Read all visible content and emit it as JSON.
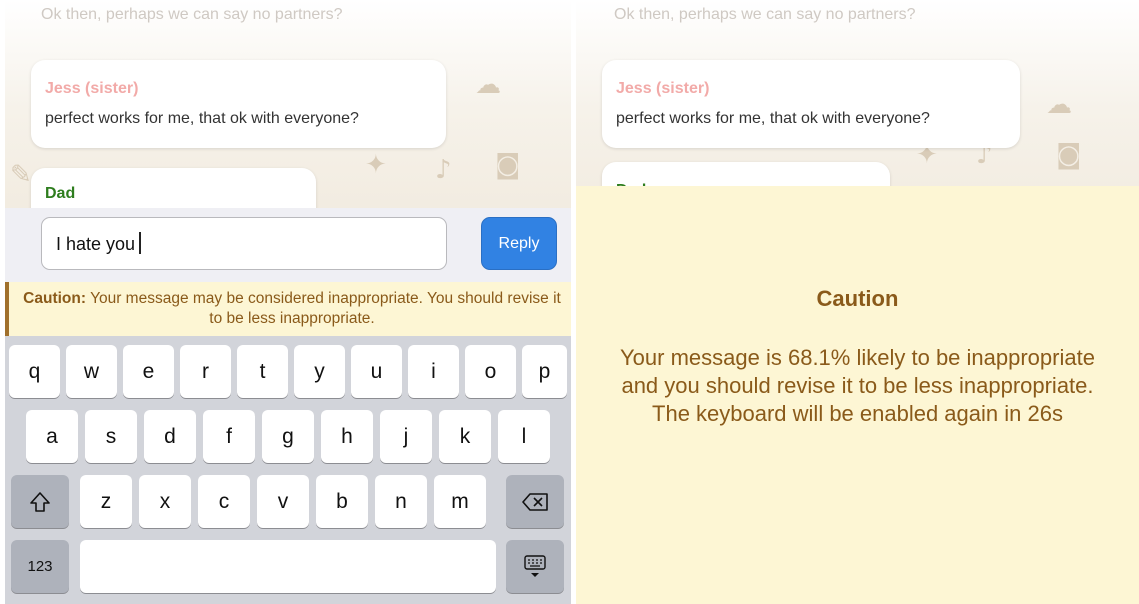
{
  "left": {
    "faded_message": "Ok then, perhaps we can say no partners?",
    "messages": [
      {
        "sender": "Jess (sister)",
        "text": "perfect works for me, that ok with everyone?"
      },
      {
        "sender": "Dad",
        "text": ""
      }
    ],
    "input": {
      "value": "I hate you"
    },
    "reply_label": "Reply",
    "caution": {
      "label": "Caution:",
      "text": "Your message may be considered inappropriate. You should revise it to be less inappropriate."
    },
    "keyboard": {
      "row1": [
        "q",
        "w",
        "e",
        "r",
        "t",
        "y",
        "u",
        "i",
        "o",
        "p"
      ],
      "row2": [
        "a",
        "s",
        "d",
        "f",
        "g",
        "h",
        "j",
        "k",
        "l"
      ],
      "row3": [
        "z",
        "x",
        "c",
        "v",
        "b",
        "n",
        "m"
      ],
      "shift_icon": "shift-icon",
      "backspace_icon": "backspace-icon",
      "numbers_label": "123",
      "dismiss_icon": "keyboard-dismiss-icon"
    }
  },
  "right": {
    "faded_message": "Ok then, perhaps we can say no partners?",
    "messages": [
      {
        "sender": "Jess (sister)",
        "text": "perfect works for me, that ok with everyone?"
      },
      {
        "sender": "Dad",
        "text": ""
      }
    ],
    "caution": {
      "title": "Caution",
      "text": "Your message is 68.1% likely to be inappropriate and you should revise it to be less inappropriate. The keyboard will be enabled again in 26s"
    }
  },
  "colors": {
    "jess_name": "#f2aaa8",
    "dad_name": "#2e7d1e",
    "reply_button": "#3182e3",
    "caution_bg": "#fdf6d4",
    "caution_text": "#8a5a1a",
    "keyboard_bg": "#d2d4da"
  }
}
